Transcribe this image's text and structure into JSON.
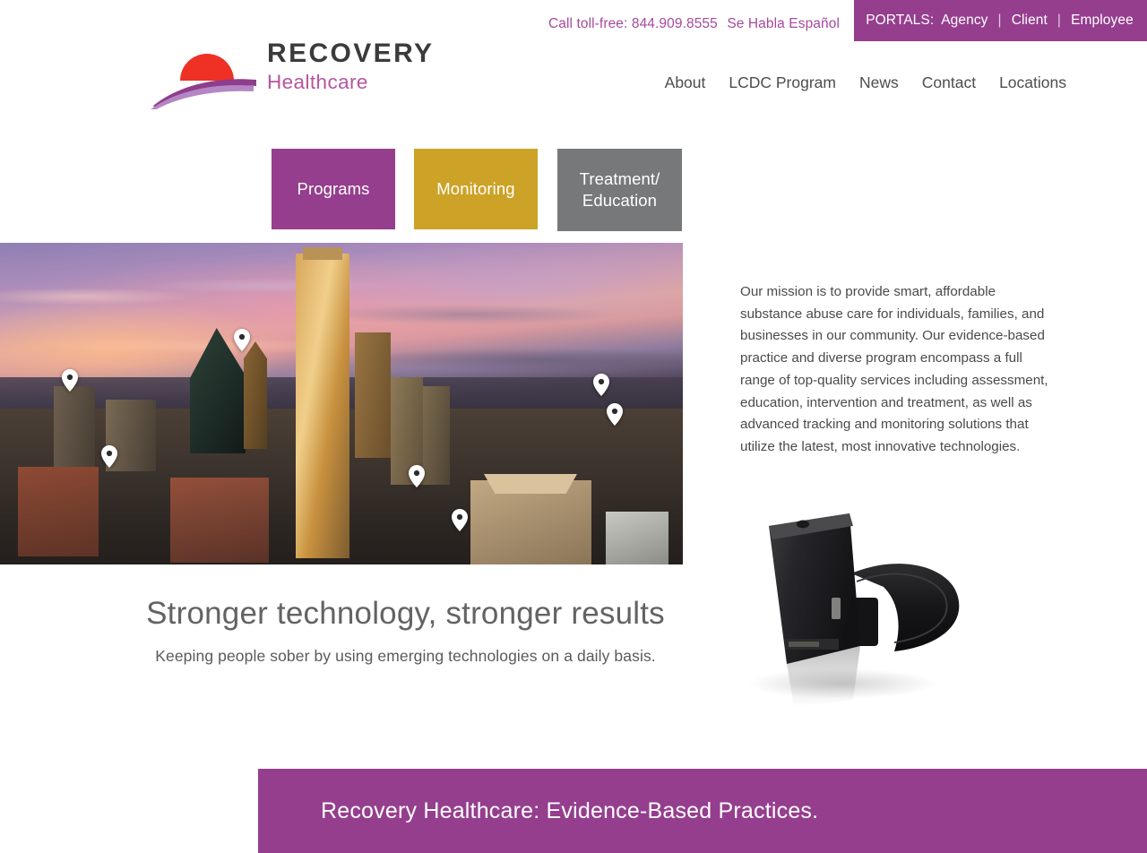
{
  "topbar": {
    "toll_free_label": "Call toll-free:",
    "phone": "844.909.8555",
    "habla": "Se Habla Español",
    "portals_label": "PORTALS:",
    "portal_links": [
      "Agency",
      "Client",
      "Employee"
    ],
    "separator": "|",
    "portal_bg": "#953E8E",
    "phone_color": "#a7499e"
  },
  "logo": {
    "primary": "RECOVERY",
    "secondary": "Healthcare",
    "sun_color": "#EE3124",
    "swoosh_dark": "#8E3E8C",
    "swoosh_light": "#B487C4",
    "primary_color": "#3b3b3b",
    "secondary_color": "#b5569f"
  },
  "mainnav": {
    "items": [
      "About",
      "LCDC Program",
      "News",
      "Contact",
      "Locations"
    ]
  },
  "tiles": [
    {
      "label": "Programs",
      "color": "#953E8E"
    },
    {
      "label": "Monitoring",
      "color": "#CCA227"
    },
    {
      "label": "Treatment/\nEducation",
      "color": "#77787A"
    }
  ],
  "tile_labels": {
    "programs": "Programs",
    "monitoring": "Monitoring",
    "treatment_line1": "Treatment/",
    "treatment_line2": "Education"
  },
  "hero": {
    "image_alt": "Dallas skyline at sunset with location map pins",
    "pin_count": 7
  },
  "mission": {
    "text": "Our mission is to provide smart, affordable substance abuse care for individuals, families, and businesses in our community. Our evidence-based practice and diverse program encompass a full range of top-quality services including assessment, education, intervention and treatment, as well as advanced tracking and monitoring solutions that utilize the latest, most innovative technologies."
  },
  "headline": {
    "title": "Stronger technology, stronger results",
    "subtitle": "Keeping people sober by using emerging technologies on a daily basis."
  },
  "device": {
    "alt": "Black ankle monitoring bracelet device"
  },
  "banner": {
    "text": "Recovery Healthcare: Evidence-Based Practices.",
    "bg": "#953E8E"
  }
}
